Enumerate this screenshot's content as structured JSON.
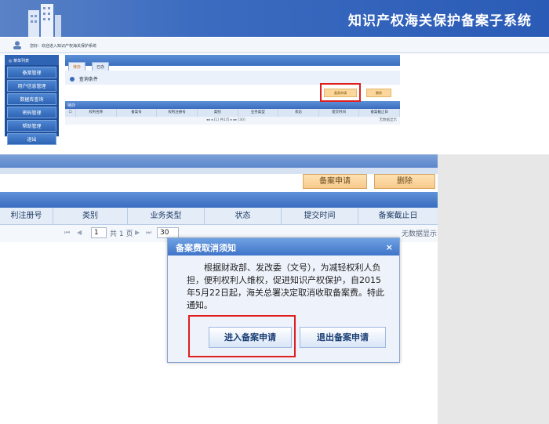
{
  "header": {
    "title": "知识产权海关保护备案子系统"
  },
  "userbar": {
    "text": "您好：欢迎进入知识产权海关保护系统"
  },
  "sidebar": {
    "heading": "◎ 菜单列表",
    "items": [
      {
        "label": "备案管理"
      },
      {
        "label": "用户信息管理"
      },
      {
        "label": "数据库查询"
      },
      {
        "label": "密码管理"
      },
      {
        "label": "帮助管理"
      },
      {
        "label": "退出"
      }
    ]
  },
  "tabs": [
    {
      "label": "待办"
    },
    {
      "label": "已办"
    }
  ],
  "query": {
    "label": "查询条件"
  },
  "mini_buttons": {
    "apply": "备案申请",
    "delete": "删除"
  },
  "list": {
    "title": "待办",
    "columns": [
      "权利名称",
      "备案号",
      "权利注册号",
      "类别",
      "业务类型",
      "状态",
      "提交时间",
      "备案截止日"
    ],
    "pager": {
      "page": "1",
      "total": "共1页",
      "size": "30",
      "empty": "无数据显示"
    }
  },
  "zoom": {
    "apply": "备案申请",
    "delete": "删除",
    "columns": [
      "利注册号",
      "类别",
      "业务类型",
      "状态",
      "提交时间",
      "备案截止日"
    ],
    "pager": {
      "page": "1",
      "total": "共 1 页",
      "size": "30",
      "empty": "无数据显示"
    }
  },
  "modal": {
    "title": "备案费取消须知",
    "close": "×",
    "body": "根据财政部、发改委（文号），为减轻权利人负担，便利权利人维权，促进知识产权保护，自2015年5月22日起，海关总署决定取消收取备案费。特此通知。",
    "enter": "进入备案申请",
    "exit": "退出备案申请"
  },
  "colors": {
    "banner": "#3c6cc0",
    "highlight": "#e01e1e",
    "button_orange": "#f8c98a"
  }
}
